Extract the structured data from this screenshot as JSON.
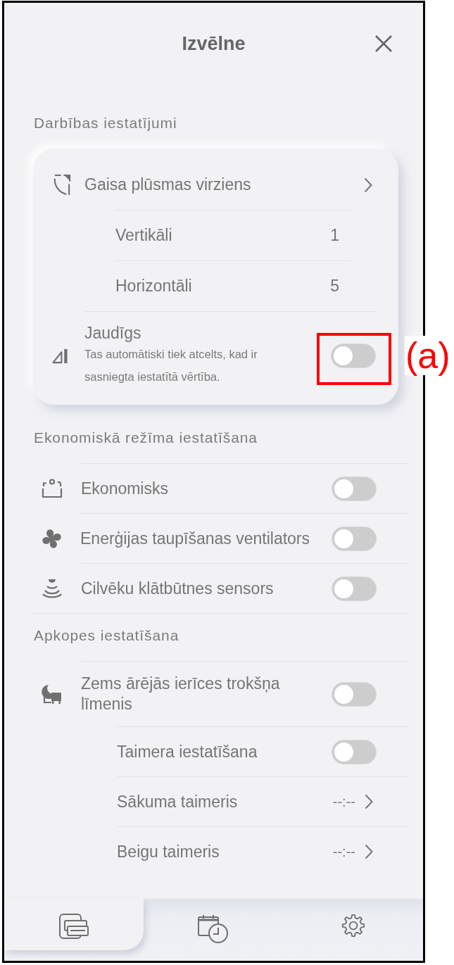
{
  "header": {
    "title": "Izvēlne"
  },
  "sections": [
    {
      "title": "Darbības iestatījumi",
      "kind": "card",
      "rows": [
        {
          "kind": "link",
          "label": "Gaisa plūsmas virziens",
          "children": [
            {
              "kind": "value",
              "label": "Vertikāli",
              "value": "1"
            },
            {
              "kind": "value",
              "label": "Horizontāli",
              "value": "5"
            }
          ]
        },
        {
          "kind": "toggle",
          "label": "Jaudīgs",
          "description": "Tas automātiski tiek atcelts, kad ir sasniegta iestatītā vērtība.",
          "on": false,
          "callout": "(a)"
        }
      ]
    },
    {
      "title": "Ekonomiskā režīma iestatīšana",
      "kind": "list",
      "rows": [
        {
          "kind": "toggle",
          "label": "Ekonomisks",
          "on": false
        },
        {
          "kind": "toggle",
          "label": "Enerģijas taupīšanas ventilators",
          "on": false
        },
        {
          "kind": "toggle",
          "label": "Cilvēku klātbūtnes sensors",
          "on": false
        }
      ]
    },
    {
      "title": "Apkopes iestatīšana",
      "kind": "list",
      "rows": [
        {
          "kind": "toggle",
          "label": "Zems ārējās ierīces trokšņa līmenis",
          "on": false,
          "children": [
            {
              "kind": "toggle",
              "label": "Taimera iestatīšana",
              "on": false
            },
            {
              "kind": "link",
              "label": "Sākuma taimeris",
              "value": "--:--"
            },
            {
              "kind": "link",
              "label": "Beigu taimeris",
              "value": "--:--"
            }
          ]
        }
      ]
    }
  ],
  "nav": [
    {
      "selected": true
    },
    {
      "selected": false
    },
    {
      "selected": false
    }
  ]
}
